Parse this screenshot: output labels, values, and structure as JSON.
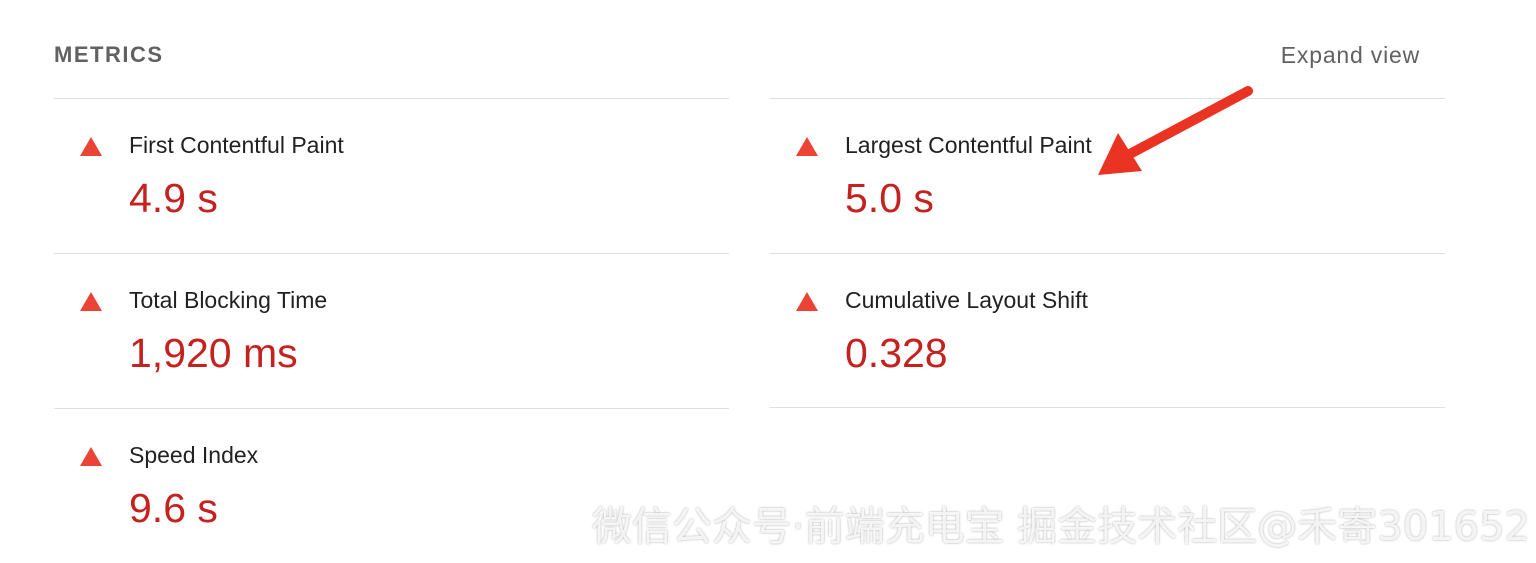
{
  "header": {
    "title": "METRICS",
    "expand_label": "Expand view"
  },
  "metrics_left": [
    {
      "label": "First Contentful Paint",
      "value": "4.9 s"
    },
    {
      "label": "Total Blocking Time",
      "value": "1,920 ms"
    },
    {
      "label": "Speed Index",
      "value": "9.6 s"
    }
  ],
  "metrics_right": [
    {
      "label": "Largest Contentful Paint",
      "value": "5.0 s"
    },
    {
      "label": "Cumulative Layout Shift",
      "value": "0.328"
    }
  ],
  "colors": {
    "fail": "#eb4335",
    "fail_text": "#c5221f",
    "annotation_arrow": "#ea3323"
  },
  "icons": {
    "metric_status": "fail-triangle-icon",
    "annotation": "red-arrow-annotation"
  },
  "watermark": "微信公众号·前端充电宝 掘金技术社区@禾寄301652"
}
